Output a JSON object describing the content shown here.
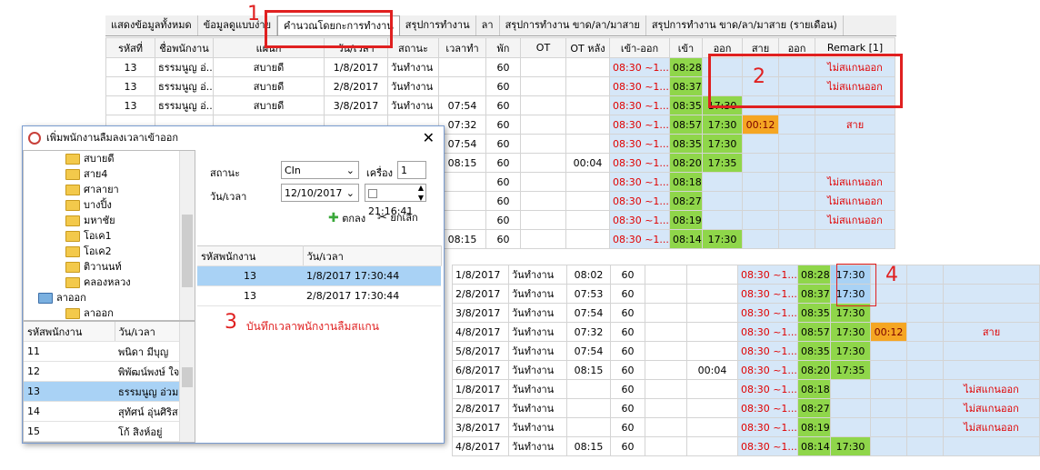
{
  "tabs": [
    "แสดงข้อมูลทั้งหมด",
    "ข้อมูลดูแบบง่าย",
    "คำนวณโดยกะการทำงาน",
    "สรุปการทำงาน",
    "ลา",
    "สรุปการทำงาน ขาด/ลา/มาสาย",
    "สรุปการทำงาน ขาด/ลา/มาสาย (รายเดือน)"
  ],
  "steps": {
    "s1": "1",
    "s2": "2",
    "s3": "3",
    "s4": "4",
    "s3_caption": "บันทึกเวลาพนักงานลืมสแกน"
  },
  "main_grid": {
    "headers": [
      "รหัสที่",
      "ชื่อพนักงาน",
      "แผนก",
      "วัน/เวลา",
      "สถานะ",
      "เวลาทำ",
      "พัก",
      "OT",
      "OT หลัง",
      "เข้า-ออก",
      "เข้า",
      "ออก",
      "สาย",
      "ออก",
      "Remark [1]"
    ],
    "rows": [
      [
        "13",
        "ธรรมนูญ อ่...",
        "สบายดี",
        "1/8/2017",
        "วันทำงาน",
        "",
        "60",
        "",
        "",
        "08:30 ~1...",
        "08:28",
        "",
        "",
        "",
        "ไม่สแกนออก"
      ],
      [
        "13",
        "ธรรมนูญ อ่...",
        "สบายดี",
        "2/8/2017",
        "วันทำงาน",
        "",
        "60",
        "",
        "",
        "08:30 ~1...",
        "08:37",
        "",
        "",
        "",
        "ไม่สแกนออก"
      ],
      [
        "13",
        "ธรรมนูญ อ่...",
        "สบายดี",
        "3/8/2017",
        "วันทำงาน",
        "07:54",
        "60",
        "",
        "",
        "08:30 ~1...",
        "08:35",
        "17:30",
        "",
        "",
        ""
      ],
      [
        "",
        "",
        "",
        "",
        "",
        "07:32",
        "60",
        "",
        "",
        "08:30 ~1...",
        "08:57",
        "17:30",
        "00:12",
        "",
        "สาย"
      ],
      [
        "",
        "",
        "",
        "",
        "",
        "07:54",
        "60",
        "",
        "",
        "08:30 ~1...",
        "08:35",
        "17:30",
        "",
        "",
        ""
      ],
      [
        "",
        "",
        "",
        "",
        "",
        "08:15",
        "60",
        "",
        "00:04",
        "08:30 ~1...",
        "08:20",
        "17:35",
        "",
        "",
        ""
      ],
      [
        "",
        "",
        "",
        "",
        "",
        "",
        "60",
        "",
        "",
        "08:30 ~1...",
        "08:18",
        "",
        "",
        "",
        "ไม่สแกนออก"
      ],
      [
        "",
        "",
        "",
        "",
        "",
        "",
        "60",
        "",
        "",
        "08:30 ~1...",
        "08:27",
        "",
        "",
        "",
        "ไม่สแกนออก"
      ],
      [
        "",
        "",
        "",
        "",
        "",
        "",
        "60",
        "",
        "",
        "08:30 ~1...",
        "08:19",
        "",
        "",
        "",
        "ไม่สแกนออก"
      ],
      [
        "",
        "",
        "",
        "",
        "",
        "08:15",
        "60",
        "",
        "",
        "08:30 ~1...",
        "08:14",
        "17:30",
        "",
        "",
        ""
      ]
    ]
  },
  "result_grid": {
    "rows": [
      [
        "1/8/2017",
        "วันทำงาน",
        "08:02",
        "60",
        "",
        "",
        "08:30 ~1...",
        "08:28",
        "17:30",
        "",
        "",
        ""
      ],
      [
        "2/8/2017",
        "วันทำงาน",
        "07:53",
        "60",
        "",
        "",
        "08:30 ~1...",
        "08:37",
        "17:30",
        "",
        "",
        ""
      ],
      [
        "3/8/2017",
        "วันทำงาน",
        "07:54",
        "60",
        "",
        "",
        "08:30 ~1...",
        "08:35",
        "17:30",
        "",
        "",
        ""
      ],
      [
        "4/8/2017",
        "วันทำงาน",
        "07:32",
        "60",
        "",
        "",
        "08:30 ~1...",
        "08:57",
        "17:30",
        "00:12",
        "",
        "สาย"
      ],
      [
        "5/8/2017",
        "วันทำงาน",
        "07:54",
        "60",
        "",
        "",
        "08:30 ~1...",
        "08:35",
        "17:30",
        "",
        "",
        ""
      ],
      [
        "6/8/2017",
        "วันทำงาน",
        "08:15",
        "60",
        "",
        "00:04",
        "08:30 ~1...",
        "08:20",
        "17:35",
        "",
        "",
        ""
      ],
      [
        "1/8/2017",
        "วันทำงาน",
        "",
        "60",
        "",
        "",
        "08:30 ~1...",
        "08:18",
        "",
        "",
        "",
        "ไม่สแกนออก"
      ],
      [
        "2/8/2017",
        "วันทำงาน",
        "",
        "60",
        "",
        "",
        "08:30 ~1...",
        "08:27",
        "",
        "",
        "",
        "ไม่สแกนออก"
      ],
      [
        "3/8/2017",
        "วันทำงาน",
        "",
        "60",
        "",
        "",
        "08:30 ~1...",
        "08:19",
        "",
        "",
        "",
        "ไม่สแกนออก"
      ],
      [
        "4/8/2017",
        "วันทำงาน",
        "08:15",
        "60",
        "",
        "",
        "08:30 ~1...",
        "08:14",
        "17:30",
        "",
        "",
        ""
      ]
    ]
  },
  "dialog": {
    "title": "เพิ่มพนักงานลืมลงเวลาเข้าออก",
    "tree": [
      "สบายดี",
      "สาย4",
      "ศาลายา",
      "บางปิ้ง",
      "มหาชัย",
      "โอเค1",
      "โอเค2",
      "ติวานนท์",
      "คลองหลวง",
      "ลาออก",
      "ลาออก"
    ],
    "status_label": "สถานะ",
    "status_value": "CIn",
    "machine_label": "เครื่อง",
    "machine_value": "1",
    "datetime_label": "วัน/เวลา",
    "date_value": "12/10/2017",
    "time_value": "21:16:41",
    "ok_label": "ตกลง",
    "cancel_label": "ยกเลิก",
    "list_headers": [
      "รหัสพนักงาน",
      "วัน/เวลา"
    ],
    "list_rows": [
      [
        "13",
        "1/8/2017 17:30:44"
      ],
      [
        "13",
        "2/8/2017 17:30:44"
      ]
    ],
    "emp_headers": [
      "รหัสพนักงาน",
      "วัน/เวลา"
    ],
    "emp_rows": [
      [
        "11",
        "พนิดา มีบุญ"
      ],
      [
        "12",
        "พิพัฒน์พงษ์ ใจ"
      ],
      [
        "13",
        "ธรรมนูญ อ่วมแ"
      ],
      [
        "14",
        "สุทัศน์ อุ่นศิริส"
      ],
      [
        "15",
        "โก้ สิงห์อยู่"
      ]
    ]
  }
}
